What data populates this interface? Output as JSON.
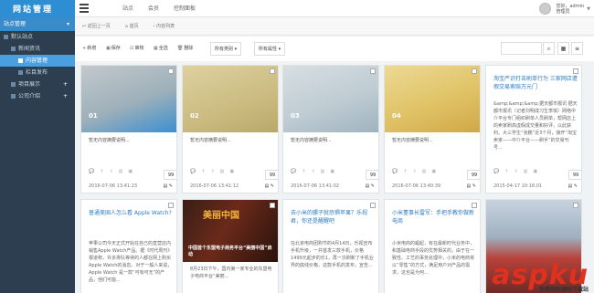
{
  "app": {
    "logo": "网站管理",
    "topnav": [
      "站点",
      "会员",
      "控制面板"
    ],
    "user_line1": "您好，admin",
    "user_line2": "管理员"
  },
  "sidebar": {
    "title": "站点管理",
    "items": [
      {
        "label": "默认站点",
        "level": 0
      },
      {
        "label": "新闻资讯",
        "level": 1
      },
      {
        "label": "内容管理",
        "level": 2,
        "active": true
      },
      {
        "label": "栏目发布",
        "level": 2
      },
      {
        "label": "项目展示",
        "level": 1
      },
      {
        "label": "公司介绍",
        "level": 1
      }
    ]
  },
  "breadcrumb": [
    "返回上一页",
    "首页",
    "内容列表"
  ],
  "toolbar": {
    "buttons": [
      "新增",
      "保存",
      "审核",
      "全选",
      "删除"
    ],
    "select1": "所有类别",
    "select2": "所有属性"
  },
  "cards_row1": [
    {
      "num": "01",
      "desc": "暂无内容摘要说明...",
      "count": "99",
      "date": "2016-07-06 13:41:23",
      "colors": [
        "#aeb7bb",
        "#2f88c6"
      ]
    },
    {
      "num": "02",
      "desc": "暂无内容摘要说明...",
      "count": "99",
      "date": "2016-07-06 13:41:12",
      "colors": [
        "#d8c98e",
        "#cdb46c"
      ]
    },
    {
      "num": "03",
      "desc": "暂无内容摘要说明...",
      "count": "99",
      "date": "2016-07-06 13:41:02",
      "colors": [
        "#cfd8dc",
        "#a9bcc6"
      ]
    },
    {
      "num": "04",
      "desc": "暂无内容摘要说明...",
      "count": "99",
      "date": "2016-07-06 13:40:39",
      "colors": [
        "#e7d288",
        "#d9b54e"
      ]
    }
  ],
  "card5": {
    "title": "淘宝严识打击刷单行为 三家网店遭假交易索赔万元门",
    "body": "&amp;&amp;&amp;据天都市报讯 据天都市报讯（记者刘明成习生李琪）网络中介平台专门组织刷单人员刷单，帮网店上的卖家刷高虚假成交量和好评，以此获利。大三学生“张鹏”近3个月，接开“淘宝卖家——中介平台——刷手”的交易刊号...",
    "count": "99",
    "date": "2015-04-17 10:16:01"
  },
  "cards_row2": [
    {
      "title": "普通美国人怎么看 Apple Watch?",
      "body": "苹果公司今天正式开始在自己的直营店内销售Apple Watch产品。据《时代周刊》报道称，许多排队等待的人都在网上购买Apple Watch的消息。对于一般人来说，Apple Watch 是一款“可有可无”的产品，他们可能..."
    },
    {
      "img_text1": "美丽中国",
      "img_text2": "中国首个东盟电子商务平台“美丽中国”启动",
      "body": "8月23日下午，国内第一家专业的东盟电子电商平台“美丽..."
    },
    {
      "title": "去小米的骡子就恐惧苹果？乐视君，你还是醒醒吧",
      "body": "在北京电商团购节的4月14日，乐视宣布手机升级，一并首发三款手机，价格1499元起步的乐1，再一次刷新了手机业界的底线价格。这款手机的发布，宣告..."
    },
    {
      "title": "小米董事长雷军：手把手教你做新电商",
      "body": "小米电商的崛起，有在最新时代业务中，和基础电商手段的优势相关的，由于在一致性、工艺的事务处理中，小米的电商将以“零售”的方式，满足用户对产品的需求，这也是为何..."
    }
  ],
  "watermark": {
    "big": "aspku",
    "small": "免费网站源码下载站"
  }
}
